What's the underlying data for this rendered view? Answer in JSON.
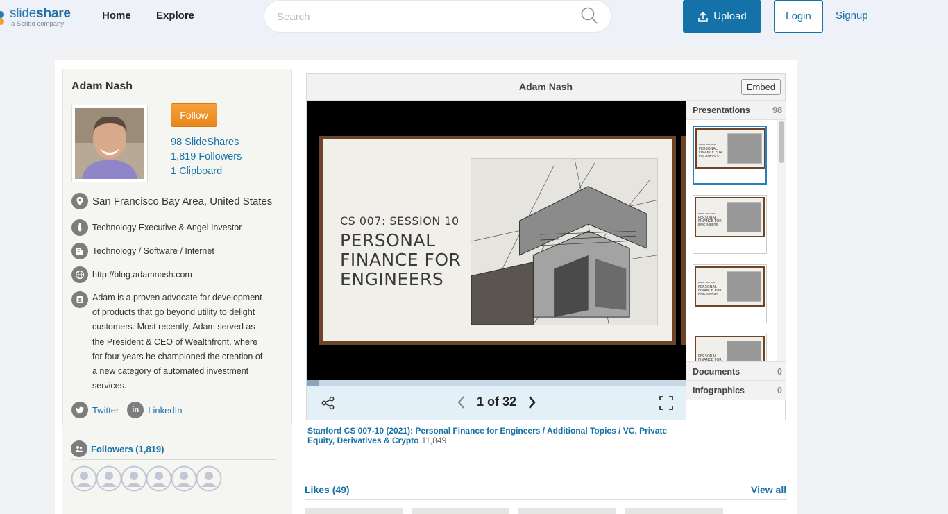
{
  "nav": {
    "logo_light": "slide",
    "logo_bold": "share",
    "logo_sub": "a Scribd company",
    "home": "Home",
    "explore": "Explore",
    "search_placeholder": "Search",
    "upload": "Upload",
    "login": "Login",
    "signup": "Signup"
  },
  "profile": {
    "name": "Adam Nash",
    "follow": "Follow",
    "slideshares": "98 SlideShares",
    "followers": "1,819 Followers",
    "clipboards": "1 Clipboard",
    "location": "San Francisco Bay Area, United States",
    "occupation": "Technology Executive & Angel Investor",
    "industry": "Technology / Software / Internet",
    "website": "http://blog.adamnash.com",
    "bio": "Adam is a proven advocate for development of products that go beyond utility to delight customers. Most recently, Adam served as the President & CEO of Wealthfront, where for four years he championed the creation of a new category of automated investment services.",
    "twitter": "Twitter",
    "linkedin": "LinkedIn",
    "followers_title": "Followers (1,819)"
  },
  "player": {
    "title": "Adam Nash",
    "embed": "Embed",
    "slide_session": "CS 007: SESSION 10",
    "slide_heading": "PERSONAL FINANCE FOR ENGINEERS",
    "page": "1 of 32",
    "progress": 0.031,
    "rail": {
      "presentations": "Presentations",
      "presentations_count": "98",
      "documents": "Documents",
      "documents_count": "0",
      "infographics": "Infographics",
      "infographics_count": "0"
    }
  },
  "deck": {
    "title": "Stanford CS 007-10 (2021): Personal Finance for Engineers / Additional Topics / VC, Private Equity, Derivatives & Crypto",
    "views": "11,849"
  },
  "likes": {
    "title": "Likes (49)",
    "view_all": "View all"
  },
  "colors": {
    "brand": "#1572a8",
    "follow": "#e88619",
    "slide_frame": "#6e4429"
  }
}
